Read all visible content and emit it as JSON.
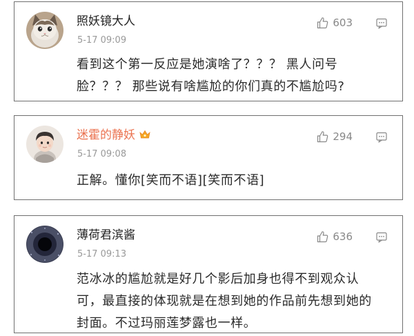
{
  "comments": [
    {
      "username": "照妖镜大人",
      "time": "5-17 09:09",
      "likes": "603",
      "text": "看到这个第一反应是她演啥了？？？ 黑人问号脸？？？ 那些说有啥尴尬的你们真的不尴尬吗?",
      "avatar": "cat-avatar"
    },
    {
      "username": "迷霍的静妖",
      "time": "5-17 09:08",
      "likes": "294",
      "text": "正解。懂你[笑而不语][笑而不语]",
      "avatar": "baby-avatar",
      "username_color": "#eb7350",
      "badge": "vip-crown-icon"
    },
    {
      "username": "薄荷君滨酱",
      "time": "5-17 09:13",
      "likes": "636",
      "text": "范冰冰的尴尬就是好几个影后加身也得不到观众认可，最直接的体现就是在想到她的作品前先想到她的封面。不过玛丽莲梦露也一样。",
      "avatar": "dark-circle-avatar"
    }
  ]
}
